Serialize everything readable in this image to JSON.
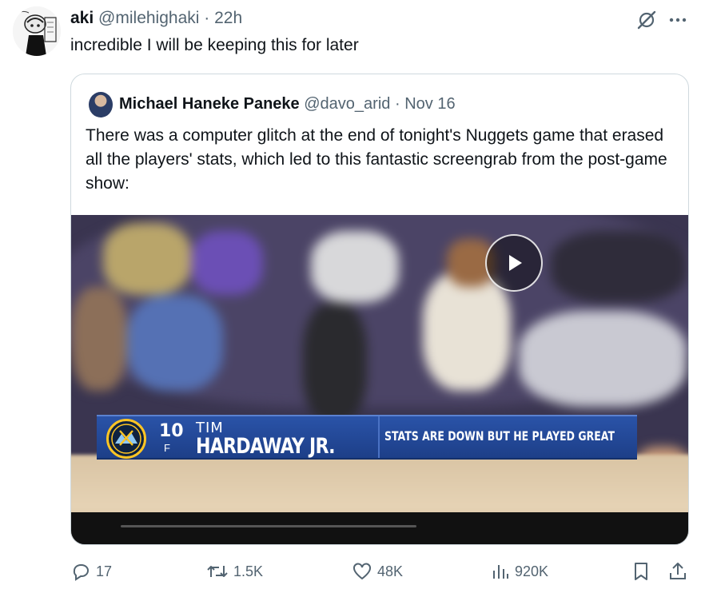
{
  "tweet": {
    "display_name": "aki",
    "handle": "@milehighaki",
    "separator": "·",
    "time": "22h",
    "text": "incredible I will be keeping this for later"
  },
  "quote": {
    "display_name": "Michael Haneke Paneke",
    "handle": "@davo_arid",
    "separator": "·",
    "date": "Nov 16",
    "text": "There was a computer glitch at the end of tonight's Nuggets game that erased all the players' stats, which led to this fantastic screengrab from the post-game show:",
    "media": {
      "jersey_number": "10",
      "position": "F",
      "first_name": "TIM",
      "last_name": "HARDAWAY JR.",
      "caption": "STATS ARE DOWN BUT HE PLAYED GREAT"
    }
  },
  "actions": {
    "replies": "17",
    "reposts": "1.5K",
    "likes": "48K",
    "views": "920K"
  },
  "icons": [
    "grok-icon",
    "more-icon",
    "play-icon",
    "reply-icon",
    "repost-icon",
    "like-icon",
    "views-icon",
    "bookmark-icon",
    "share-icon",
    "nuggets-logo"
  ],
  "colors": {
    "text": "#0f1419",
    "muted": "#536471",
    "border": "#cfd9de",
    "lower_third": "#1d3f88",
    "nuggets_gold": "#fec524"
  }
}
